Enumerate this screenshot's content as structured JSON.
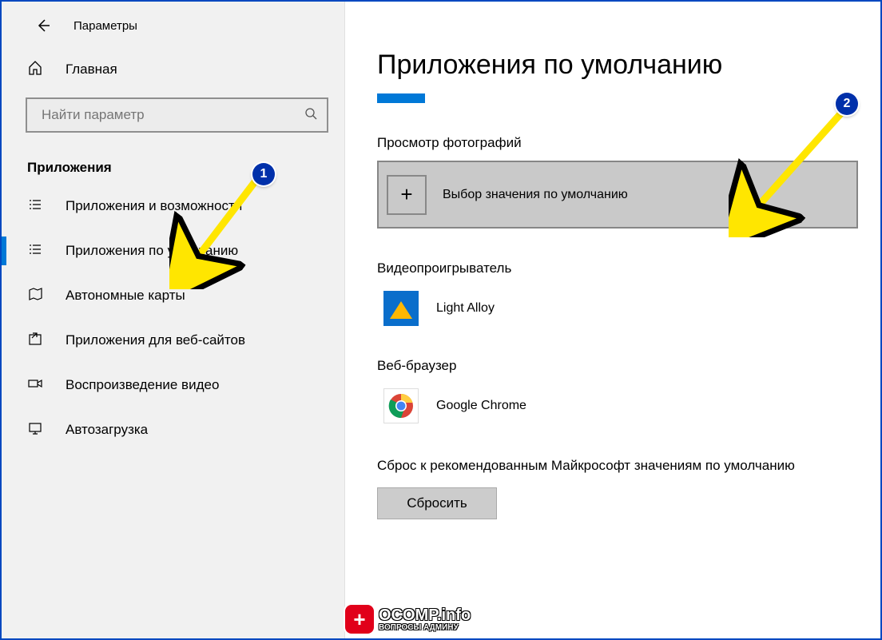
{
  "window": {
    "title": "Параметры"
  },
  "sidebar": {
    "home_label": "Главная",
    "search_placeholder": "Найти параметр",
    "group_title": "Приложения",
    "items": [
      {
        "label": "Приложения и возможности"
      },
      {
        "label": "Приложения по умолчанию"
      },
      {
        "label": "Автономные карты"
      },
      {
        "label": "Приложения для веб-сайтов"
      },
      {
        "label": "Воспроизведение видео"
      },
      {
        "label": "Автозагрузка"
      }
    ]
  },
  "main": {
    "heading": "Приложения по умолчанию",
    "sections": {
      "photo": {
        "title": "Просмотр фотографий",
        "chooser_label": "Выбор значения по умолчанию"
      },
      "video": {
        "title": "Видеопроигрыватель",
        "app": "Light Alloy"
      },
      "browser": {
        "title": "Веб-браузер",
        "app": "Google Chrome"
      }
    },
    "reset": {
      "label": "Сброс к рекомендованным Майкрософт значениям по умолчанию",
      "button": "Сбросить"
    }
  },
  "annotations": {
    "badge1": "1",
    "badge2": "2"
  },
  "watermark": {
    "symbol": "+",
    "line1": "OCOMP.info",
    "line2": "ВОПРОСЫ АДМИНУ"
  }
}
